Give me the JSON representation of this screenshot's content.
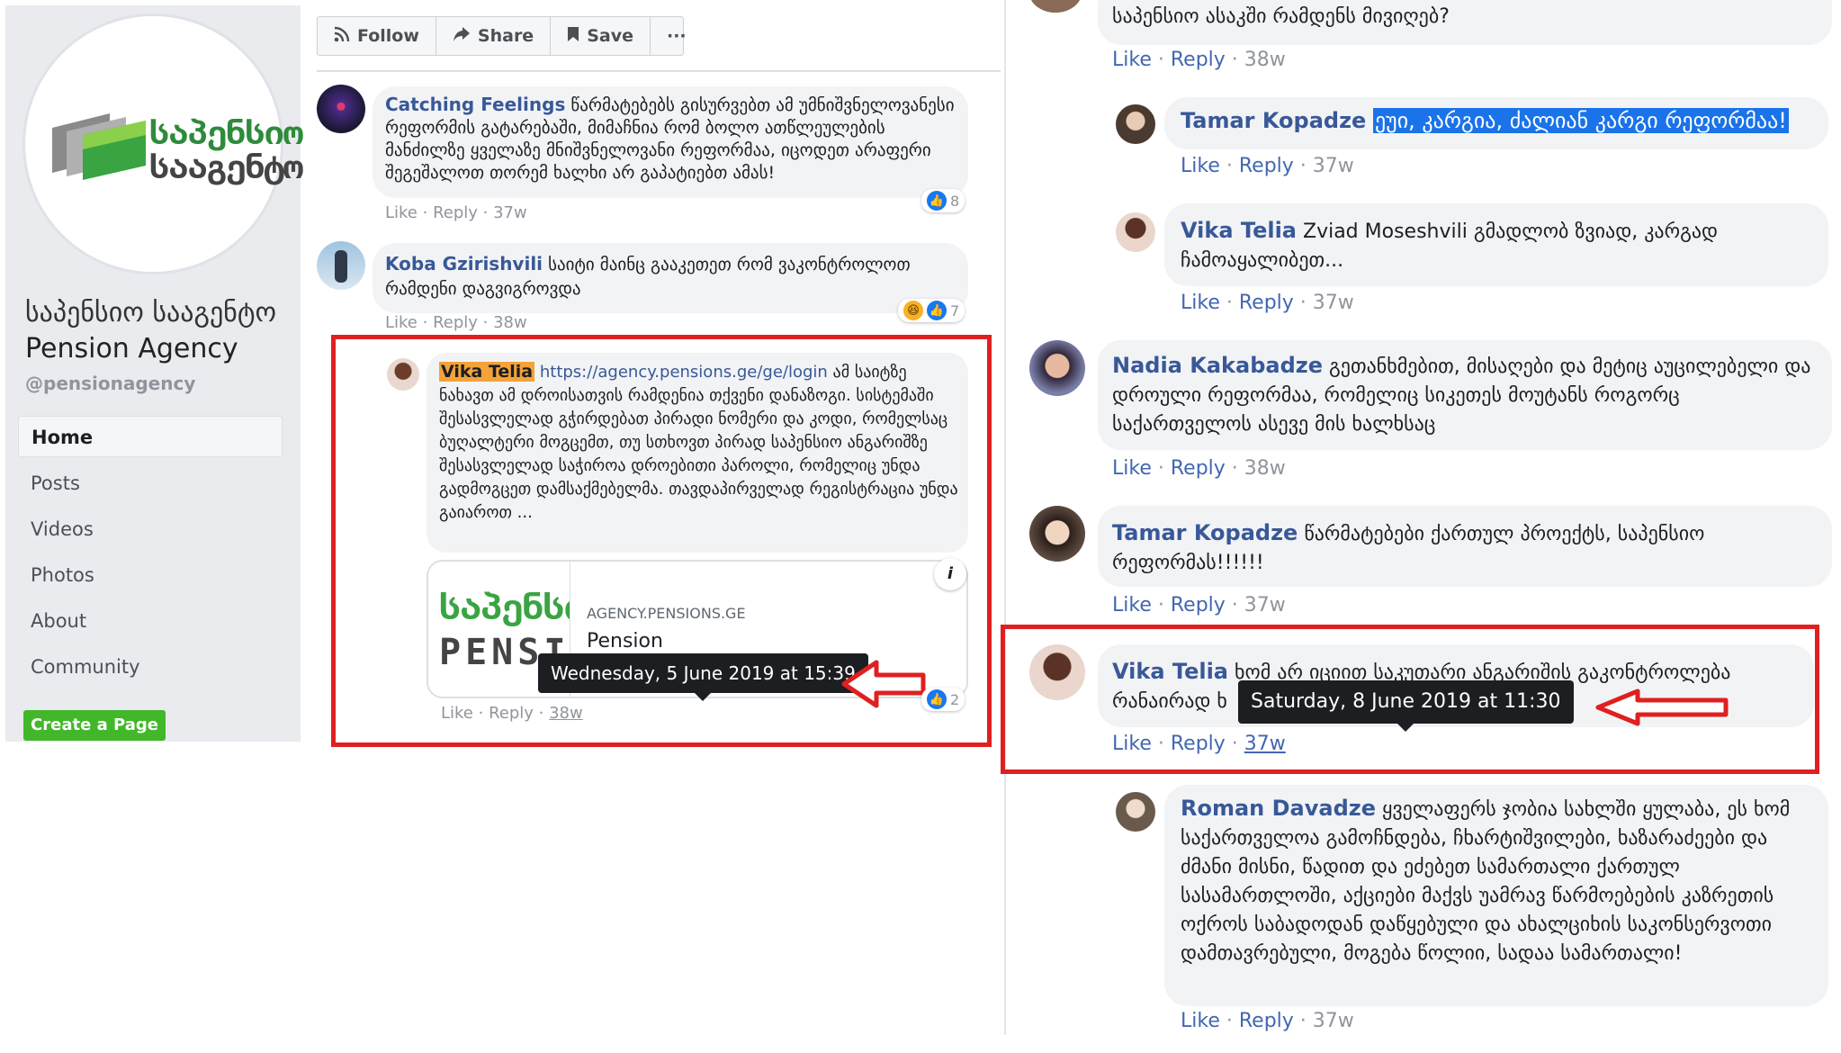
{
  "sidebar": {
    "logo_text": [
      "საპენსიო",
      "სააგენტო"
    ],
    "page_name_ka": "საპენსიო სააგენტო",
    "page_name_en": "Pension Agency",
    "handle": "@pensionagency",
    "nav": [
      "Home",
      "Posts",
      "Videos",
      "Photos",
      "About",
      "Community"
    ],
    "create_page": "Create a Page"
  },
  "toolbar": {
    "follow": "Follow",
    "share": "Share",
    "save": "Save",
    "more": "···"
  },
  "middle": {
    "c1": {
      "name": "Catching Feelings",
      "text": "წარმატებებს გისურვებთ ამ უმნიშვნელოვანესი რეფორმის გატარებაში, მიმაჩნია რომ ბოლო ათწლეულების მანძილზე ყველაზე მნიშვნელოვანი რეფორმაა, იცოდეთ არაფერი შეგეშალოთ თორემ ხალხი არ გაპატიებთ ამას!",
      "like": "Like",
      "reply": "Reply",
      "time": "37w",
      "reactions": "8"
    },
    "c2": {
      "name": "Koba Gzirishvili",
      "text": "საიტი მაინც გააკეთეთ რომ ვაკონტროლოთ რამდენი დაგვიგროვდა",
      "like": "Like",
      "reply": "Reply",
      "time": "38w",
      "reactions": "7"
    },
    "c3": {
      "name": "Vika Telia",
      "link": "https://agency.pensions.ge/ge/login",
      "text": "ამ საიტზე ნახავთ ამ დროისათვის რამდენია თქვენი დანაზოგი. სისტემაში შესასვლელად გჭირდებათ პირადი ნომერი და კოდი, რომელსაც ბუღალტერი მოგცემთ, თუ სთხოვთ პირად საპენსიო ანგარიშზე შესასვლელად საჭიროა დროებითი პაროლი, რომელიც უნდა გადმოგცეთ დამსაქმებელმა. თავდაპირველად რეგისტრაცია უნდა გაიაროთ ...",
      "preview_logo_1": "საპენსი",
      "preview_logo_2": "PENSI",
      "preview_domain": "AGENCY.PENSIONS.GE",
      "preview_title": "Pension",
      "info": "i",
      "tooltip": "Wednesday, 5 June 2019 at 15:39",
      "like": "Like",
      "reply": "Reply",
      "time": "38w",
      "reactions": "2"
    }
  },
  "right": {
    "c0": {
      "text": "საპენსიო ასაკში რამდენს მივიღებ?",
      "like": "Like",
      "reply": "Reply",
      "time": "38w"
    },
    "c1": {
      "name": "Tamar Kopadze",
      "text": "ეუი, კარგია, ძალიან კარგი რეფორმაა!",
      "like": "Like",
      "reply": "Reply",
      "time": "37w"
    },
    "c2": {
      "name": "Vika Telia",
      "text": "Zviad Moseshvili გმადლობ ზვიად, კარგად ჩამოაყალიბეთ...",
      "like": "Like",
      "reply": "Reply",
      "time": "37w"
    },
    "c3": {
      "name": "Nadia Kakabadze",
      "text": "გეთანხმებით, მისაღები და მეტიც აუცილებელი და დროული რეფორმაა, რომელიც სიკეთეს მოუტანს როგორც საქართველოს ასევე მის ხალხსაც",
      "like": "Like",
      "reply": "Reply",
      "time": "38w"
    },
    "c4": {
      "name": "Tamar Kopadze",
      "text": "წარმატებები ქართულ პროექტს, საპენსიო რეფორმას!!!!!!",
      "like": "Like",
      "reply": "Reply",
      "time": "37w"
    },
    "c5": {
      "name": "Vika Telia",
      "text_visible_1": "ხომ არ იციით საკუთარი ანგარიშის გაკონტროლება",
      "text_visible_2": "რანაირად ხ",
      "tooltip": "Saturday, 8 June 2019 at 11:30",
      "like": "Like",
      "reply": "Reply",
      "time": "37w"
    },
    "c6": {
      "name": "Roman Davadze",
      "text": "ყველაფერს ჯობია სახლში ყულაბა, ეს ხომ საქართველოა გამოჩნდება, ჩხარტიშვილები, ხაზარაძეები და ძმანი მისნი, წადით და ეძებეთ სამართალი ქართულ სასამართლოში, აქციები მაქვს უამრავ წარმოებების კაზრეთის ოქროს საბადოდან დაწყებული და ახალციხის საკონსერვოთი დამთავრებული, მოგება წოლიი, სადაა სამართალი!",
      "like": "Like",
      "reply": "Reply",
      "time": "37w"
    }
  },
  "colors": {
    "name_blue": "#385898",
    "meta_gray": "#90949c",
    "highlight_red": "#e02020",
    "selection_blue": "#1a73e8",
    "mention_orange": "#f4a23a",
    "create_green": "#42b72a"
  }
}
